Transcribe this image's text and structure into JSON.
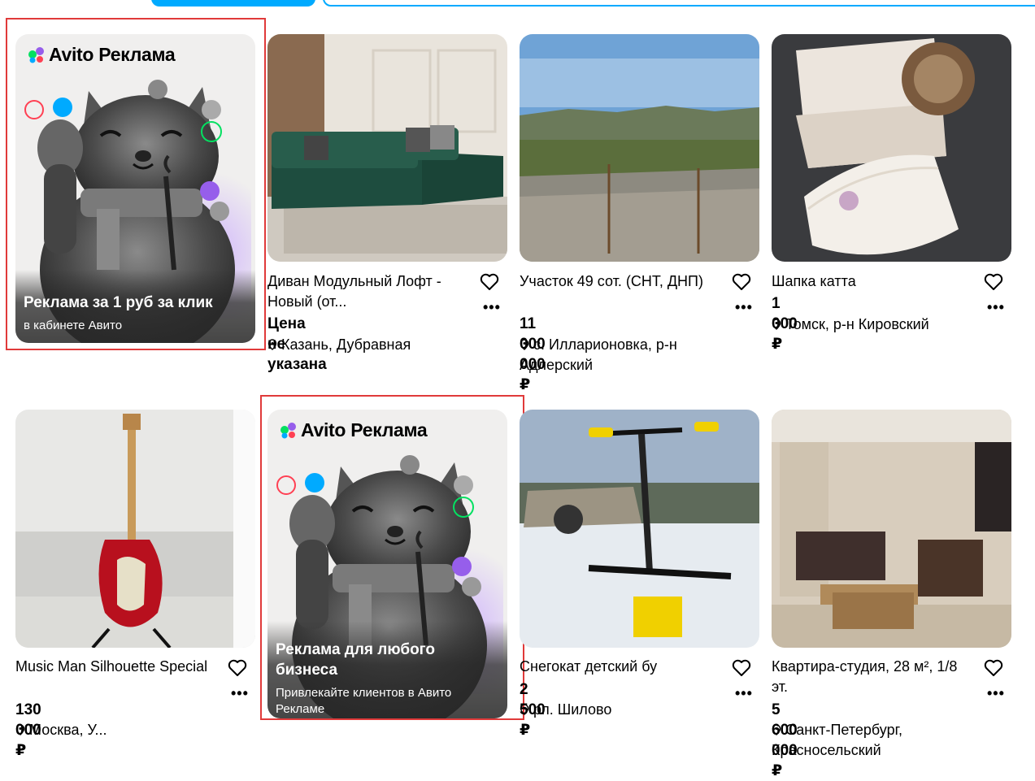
{
  "ads": [
    {
      "brand": "Avito Реклама",
      "headline": "Реклама за 1 руб за клик",
      "subtext": "в кабинете Авито"
    },
    {
      "brand": "Avito Реклама",
      "headline": "Реклама для любого бизнеса",
      "subtext": "Привлекайте клиентов в Авито Рекламе"
    }
  ],
  "listings": [
    {
      "title": "Диван Модульный Лофт - Новый (от...",
      "price": "Цена не указана",
      "location": "Казань, Дубравная"
    },
    {
      "title": "Участок 49 сот. (СНТ, ДНП)",
      "price": "11 000 000 ₽",
      "location": "с. Илларионовка, р-н Адлерский"
    },
    {
      "title": "Шапка катта",
      "price": "1 000 ₽",
      "location": "Томск, р-н Кировский"
    },
    {
      "title": "Music Man Silhouette Special",
      "price": "130 000 ₽",
      "location": "Москва, У..."
    },
    {
      "title": "Снегокат детский бу",
      "price": "2 500 ₽",
      "location": "рп. Шилово"
    },
    {
      "title": "Квартира-студия, 28 м², 1/8 эт.",
      "price": "5 600 000 ₽",
      "location": "Санкт-Петербург, Красносельский"
    }
  ],
  "colors": {
    "accent": "#00aaff",
    "highlight": "#e03a3a"
  },
  "icons": {
    "favorite": "heart-icon",
    "more": "more-dots-icon",
    "location": "pin-icon"
  }
}
